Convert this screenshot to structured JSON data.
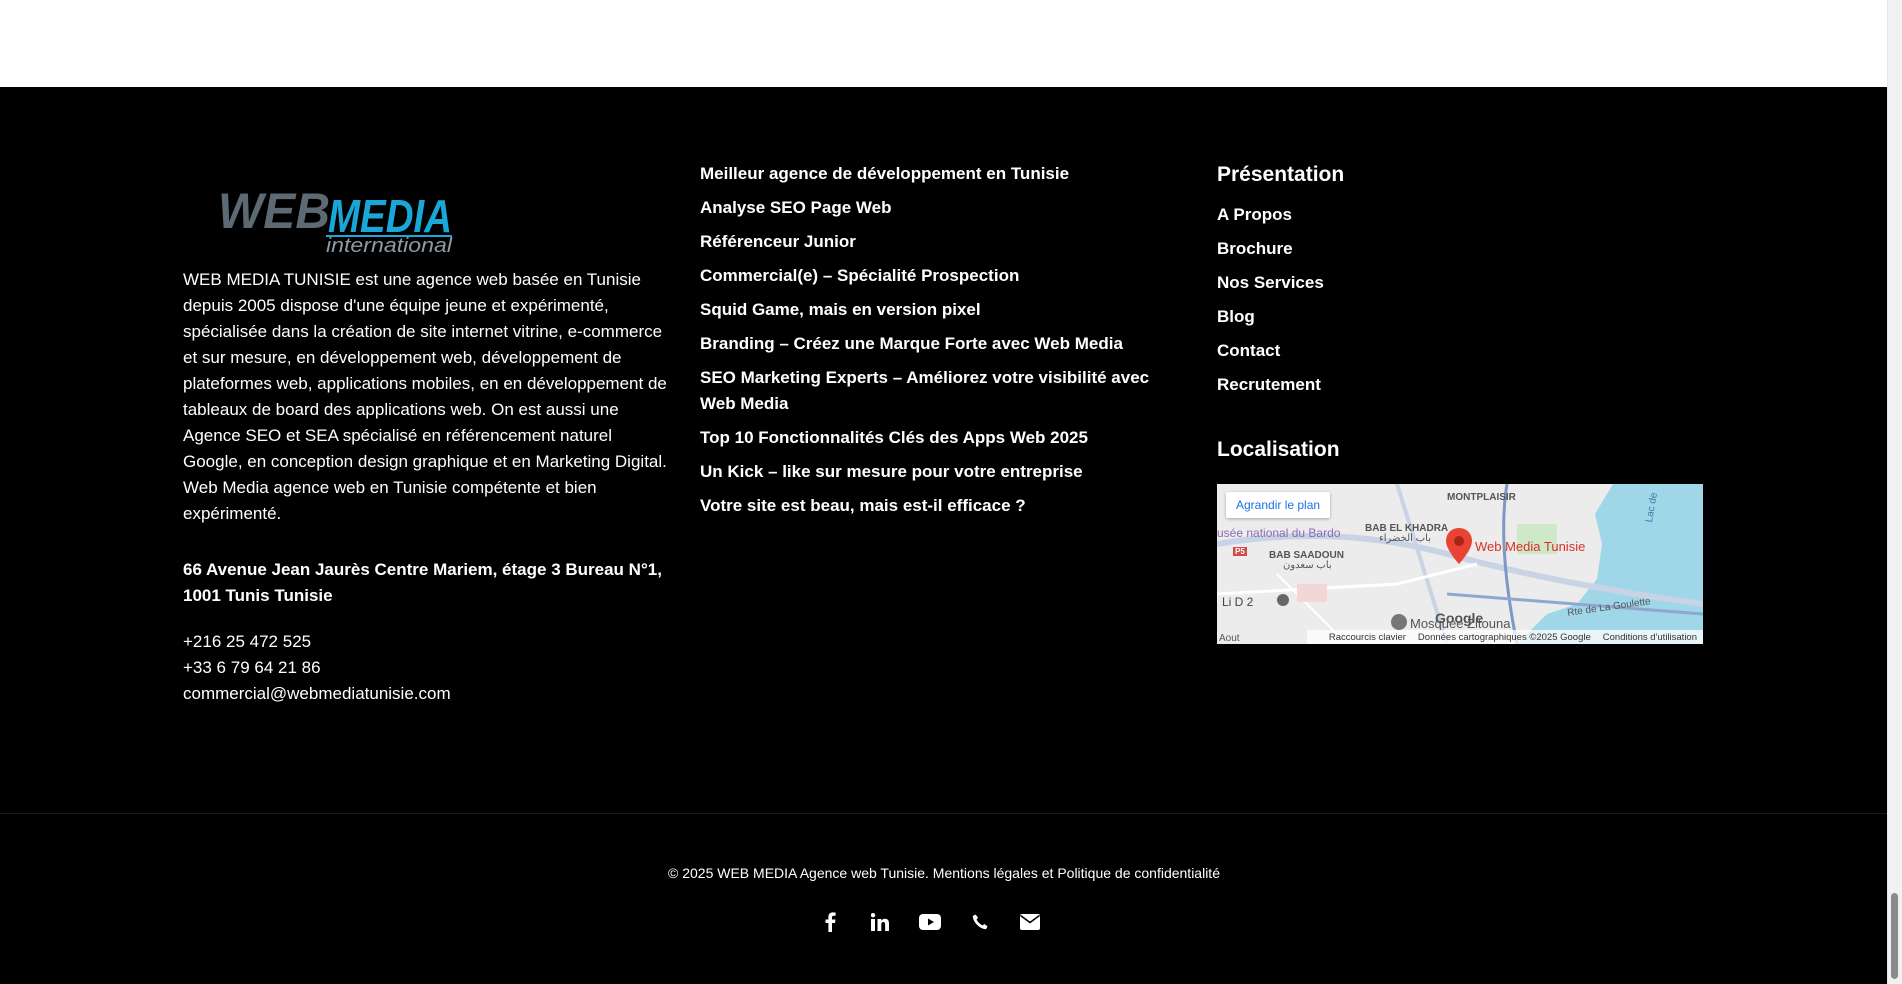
{
  "brand": {
    "logo_main": "WEB MEDIA",
    "logo_sub": "international",
    "about": "WEB MEDIA TUNISIE est une agence web basée en Tunisie depuis 2005 dispose d'une équipe jeune et expérimenté, spécialisée dans la création de site internet vitrine, e-commerce et sur mesure, en développement web, développement de plateformes web, applications mobiles, en en développement de tableaux de board des applications web. On est aussi une Agence SEO et SEA spécialisé en référencement naturel Google, en conception design graphique et en Marketing Digital. Web Media agence web en Tunisie compétente et bien expérimenté."
  },
  "address": "66 Avenue Jean Jaurès Centre Mariem,  étage 3 Bureau N°1, 1001 Tunis Tunisie",
  "contact": {
    "phone1": "+216 25 472 525",
    "phone2": "+33 6 79 64 21 86",
    "email": "commercial@webmediatunisie.com"
  },
  "posts": [
    "Meilleur agence de développement en Tunisie",
    "Analyse SEO Page Web",
    "Référenceur Junior",
    "Commercial(e) – Spécialité Prospection",
    "Squid Game, mais en version pixel",
    "Branding – Créez une Marque Forte avec Web Media",
    "SEO Marketing Experts – Améliorez votre visibilité avec Web Media",
    "Top 10 Fonctionnalités Clés des Apps Web 2025",
    "Un Kick – like sur mesure pour votre entreprise",
    "Votre site est beau, mais est-il efficace ?"
  ],
  "presentation": {
    "title": "Présentation",
    "items": [
      "A Propos",
      "Brochure",
      "Nos Services",
      "Blog",
      "Contact",
      "Recrutement"
    ]
  },
  "localisation": {
    "title": "Localisation",
    "map": {
      "enlarge": "Agrandir le plan",
      "place": "Web Media Tunisie",
      "labels": {
        "montplaisir": "MONTPLAISIR",
        "bab_el_khadra": "BAB EL KHADRA",
        "bab_el_khadra_ar": "باب الخضراء",
        "bab_saadoun": "BAB SAADOUN",
        "bab_saadoun_ar": "باب سعدون",
        "bardo": "usée national du Bardo",
        "ld2": "Li D 2",
        "zitouna": "Mosquée Zitouna",
        "goulette": "Rte de La Goulette",
        "lac": "Lac de",
        "aout": "Aout",
        "p5": "P5"
      },
      "google": "Google",
      "footer": {
        "shortcuts": "Raccourcis clavier",
        "data": "Données cartographiques ©2025 Google",
        "terms": "Conditions d'utilisation"
      },
      "colors": {
        "water": "#9fd6e8",
        "pin": "#ea4335"
      }
    }
  },
  "copyright": "© 2025 WEB MEDIA Agence web Tunisie. Mentions légales et Politique de confidentialité",
  "socials": [
    "facebook-icon",
    "linkedin-icon",
    "youtube-icon",
    "phone-icon",
    "email-icon"
  ]
}
